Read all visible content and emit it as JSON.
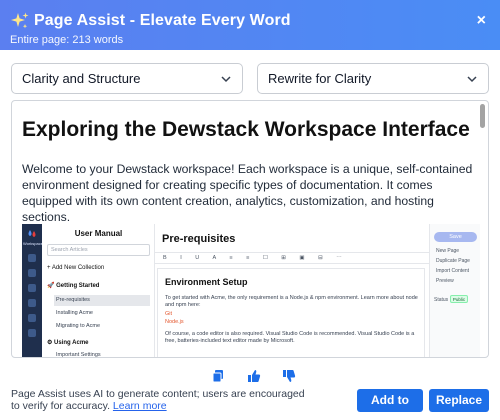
{
  "header": {
    "title": "Page Assist - Elevate Every Word",
    "subtitle": "Entire page: 213 words",
    "close_symbol": "×",
    "sparkle_icon": "sparkle-icon"
  },
  "selects": {
    "mode": "Clarity and Structure",
    "action": "Rewrite for Clarity"
  },
  "content": {
    "heading": "Exploring the Dewstack Workspace Interface",
    "paragraph": "Welcome to your Dewstack workspace! Each workspace is a unique, self-contained environment designed for creating specific types of documentation. It comes equipped with its own content creation, analytics, customization, and hosting sections.",
    "screenshot": {
      "rail_label": "Workspace",
      "panel_title": "User Manual",
      "search_placeholder": "Search Articles",
      "new_collection": "+ Add New Collection",
      "group1": "🚀 Getting Started",
      "items": [
        "Pre-requisites",
        "Installing Acme",
        "Migrating to Acme"
      ],
      "group2": "⚙ Using Acme",
      "group2_item": "Important Settings",
      "editor_title": "Pre-requisites",
      "toolbar": "B I U A ≡ ≡ ☐ ⊞ ▣ ⊟ ⋯",
      "doc_heading": "Environment Setup",
      "doc_text1": "To get started with Acme, the only requirement is a Node.js & npm environment. Learn more about node and npm here:",
      "doc_link1": "Git",
      "doc_link2": "Node.js",
      "doc_text2": "Of course, a code editor is also required. Visual Studio Code is recommended. Visual Studio Code is a free, batteries-included text editor made by Microsoft.",
      "save_label": "Save",
      "right_actions": [
        "New Page",
        "Duplicate Page",
        "Import Content",
        "Preview"
      ],
      "status_label": "Status",
      "status_value": "Public"
    }
  },
  "feedback": {
    "copy_icon": "copy-icon",
    "like_icon": "thumbs-up-icon",
    "dislike_icon": "thumbs-down-icon"
  },
  "footer": {
    "disclaimer": "Page Assist uses AI to generate content; users are encouraged to verify for accuracy. ",
    "learn_more": "Learn more",
    "add_label": "Add to Page",
    "replace_label": "Replace all"
  },
  "colors": {
    "header_start": "#5b7ff0",
    "header_end": "#4a8df5",
    "primary_button": "#1d6ee8",
    "link": "#2563eb"
  }
}
